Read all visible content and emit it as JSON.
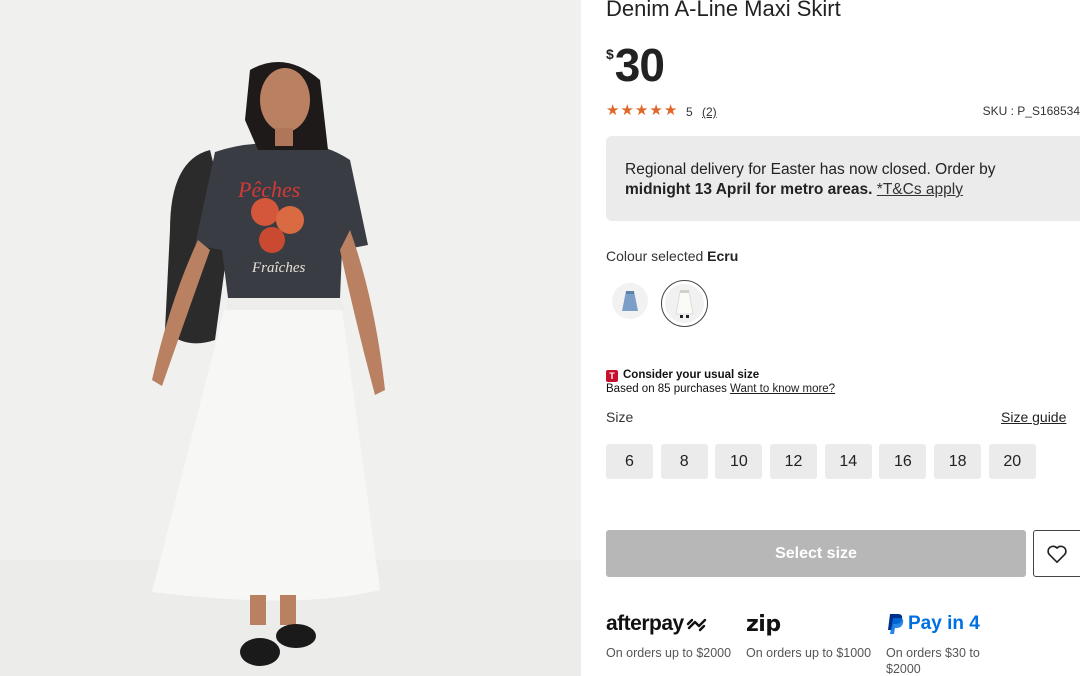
{
  "product": {
    "title": "Denim A-Line Maxi Skirt",
    "currency_symbol": "$",
    "price": "30",
    "rating": "5",
    "review_count": "(2)",
    "sku": "SKU : P_S168534"
  },
  "notice": {
    "text_1": "Regional delivery for Easter has now closed. Order by",
    "text_bold": "midnight 13 April for metro areas.",
    "link": "*T&Cs apply"
  },
  "colour": {
    "label": "Colour selected",
    "selected": "Ecru"
  },
  "fit": {
    "logo": "T",
    "title": "Consider your usual size",
    "subtitle": "Based on 85 purchases",
    "link": "Want to know more?"
  },
  "size": {
    "label": "Size",
    "guide": "Size guide",
    "options": [
      "6",
      "8",
      "10",
      "12",
      "14",
      "16",
      "18",
      "20"
    ]
  },
  "actions": {
    "select_size": "Select size"
  },
  "payments": {
    "afterpay": {
      "logo": "afterpay",
      "text": "On orders up to $2000"
    },
    "zip": {
      "logo": "zip",
      "text": "On orders up to $1000"
    },
    "paypal": {
      "logo": "Pay in 4",
      "text": "On orders $30 to $2000"
    }
  },
  "colors": {
    "star": "#e0662a",
    "button_disabled": "#b7b7b7",
    "notice_bg": "#ebebeb",
    "size_bg": "#ebebeb"
  }
}
